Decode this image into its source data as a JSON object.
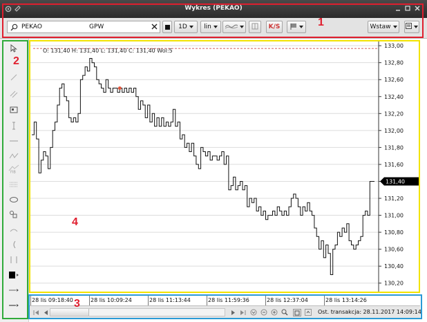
{
  "window": {
    "title": "Wykres (PEKAO)"
  },
  "toolbar": {
    "symbol": "PEKAO",
    "exchange": "GPW",
    "interval": "1D",
    "scale": "lin",
    "ks_label": "K/S",
    "insert_label": "Wstaw"
  },
  "chart": {
    "ohlc_text": "O: 131,40 H: 131,40 L: 131,40 C: 131,40 Wol:5",
    "last_price_label": "131,40"
  },
  "chart_data": {
    "type": "line",
    "y_ticks": [
      "133,00",
      "132,80",
      "132,60",
      "132,40",
      "132,20",
      "132,00",
      "131,80",
      "131,60",
      "131,40",
      "131,20",
      "131,00",
      "130,80",
      "130,60",
      "130,40",
      "130,20"
    ],
    "ylim": [
      130.1,
      133.05
    ],
    "x_labels": [
      "28 lis 09:18:40",
      "28 lis 10:09:24",
      "28 lis 11:13:44",
      "28 lis 11:59:36",
      "28 lis 12:37:04",
      "28 lis 13:14:26"
    ],
    "reference_line": 133.0,
    "last_price": 131.4,
    "series": [
      {
        "values": [
          131.95,
          132.1,
          131.9,
          131.5,
          131.65,
          131.75,
          131.7,
          131.55,
          131.8,
          132.0,
          132.1,
          132.3,
          132.5,
          132.55,
          132.4,
          132.35,
          132.15,
          132.1,
          132.15,
          132.1,
          132.2,
          132.6,
          132.65,
          132.75,
          132.7,
          132.85,
          132.8,
          132.75,
          132.6,
          132.55,
          132.5,
          132.45,
          132.6,
          132.5,
          132.45,
          132.5,
          132.5,
          132.45,
          132.5,
          132.45,
          132.5,
          132.45,
          132.5,
          132.45,
          132.5,
          132.4,
          132.25,
          132.35,
          132.3,
          132.15,
          132.3,
          132.1,
          132.2,
          132.05,
          132.15,
          132.05,
          132.15,
          132.05,
          132.1,
          132.05,
          132.1,
          132.25,
          132.05,
          132.1,
          131.9,
          131.95,
          131.8,
          131.85,
          131.75,
          131.85,
          131.7,
          131.6,
          131.55,
          131.8,
          131.75,
          131.7,
          131.75,
          131.65,
          131.7,
          131.7,
          131.65,
          131.7,
          131.75,
          131.6,
          131.7,
          131.3,
          131.35,
          131.45,
          131.3,
          131.35,
          131.4,
          131.3,
          131.35,
          131.1,
          131.2,
          131.15,
          131.2,
          131.05,
          131.1,
          131.0,
          131.05,
          130.95,
          131.0,
          131.0,
          131.05,
          131.0,
          131.1,
          131.05,
          131.0,
          131.05,
          131.0,
          131.1,
          131.2,
          131.25,
          131.2,
          131.1,
          131.0,
          131.1,
          131.05,
          131.15,
          131.05,
          131.0,
          130.85,
          130.75,
          130.6,
          130.7,
          130.5,
          130.65,
          130.55,
          130.3,
          130.6,
          130.65,
          130.8,
          130.75,
          130.85,
          130.8,
          130.9,
          130.7,
          130.65,
          130.6,
          130.65,
          130.7,
          130.75,
          131.0,
          131.05,
          131.0,
          131.4,
          131.4,
          131.4
        ]
      }
    ]
  },
  "timeaxis": {
    "labels": [
      "28 lis 09:18:40",
      "28 lis 10:09:24",
      "28 lis 11:13:44",
      "28 lis 11:59:36",
      "28 lis 12:37:04",
      "28 lis 13:14:26"
    ]
  },
  "statusbar": {
    "last_trade": "Ost. transakcja: 28.11.2017 14:09:14"
  },
  "annotations": [
    "1",
    "2",
    "3",
    "4"
  ]
}
